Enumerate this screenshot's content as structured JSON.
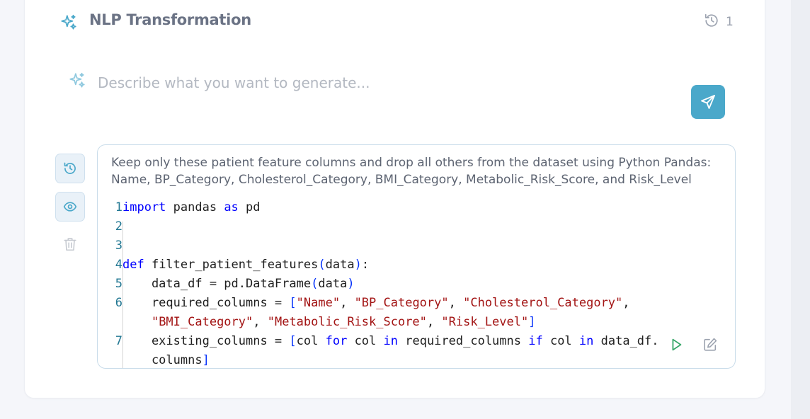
{
  "header": {
    "title": "NLP Transformation",
    "history_count": "1",
    "title_icon": "sparkles-icon",
    "history_icon": "history-icon"
  },
  "prompt": {
    "placeholder": "Describe what you want to generate...",
    "value": "",
    "icon": "sparkles-icon",
    "send_icon": "send-icon"
  },
  "side_actions": {
    "restore_icon": "history-icon",
    "view_icon": "eye-icon",
    "delete_icon": "trash-icon"
  },
  "entry": {
    "description": "Keep only these patient feature columns and drop all others from the dataset using Python Pandas: Name, BP_Category, Cholesterol_Category, BMI_Category, Metabolic_Risk_Score, and Risk_Level",
    "code_lines": [
      {
        "n": "1",
        "text": "import pandas as pd"
      },
      {
        "n": "2",
        "text": ""
      },
      {
        "n": "3",
        "text": ""
      },
      {
        "n": "4",
        "text": "def filter_patient_features(data):"
      },
      {
        "n": "5",
        "text": "data_df = pd.DataFrame(data)"
      },
      {
        "n": "6",
        "text": "required_columns = [\"Name\", \"BP_Category\", \"Cholesterol_Category\","
      },
      {
        "n": "",
        "text": "\"BMI_Category\", \"Metabolic_Risk_Score\", \"Risk_Level\"]"
      },
      {
        "n": "7",
        "text": "existing_columns = [col for col in required_columns if col in data_df."
      },
      {
        "n": "",
        "text": "columns]"
      }
    ],
    "run_icon": "play-icon",
    "edit_icon": "edit-icon"
  },
  "colors": {
    "accent": "#4aa8ca",
    "title": "#6b7385",
    "keyword": "#0000ff",
    "string": "#a31515",
    "line_number": "#237893"
  }
}
